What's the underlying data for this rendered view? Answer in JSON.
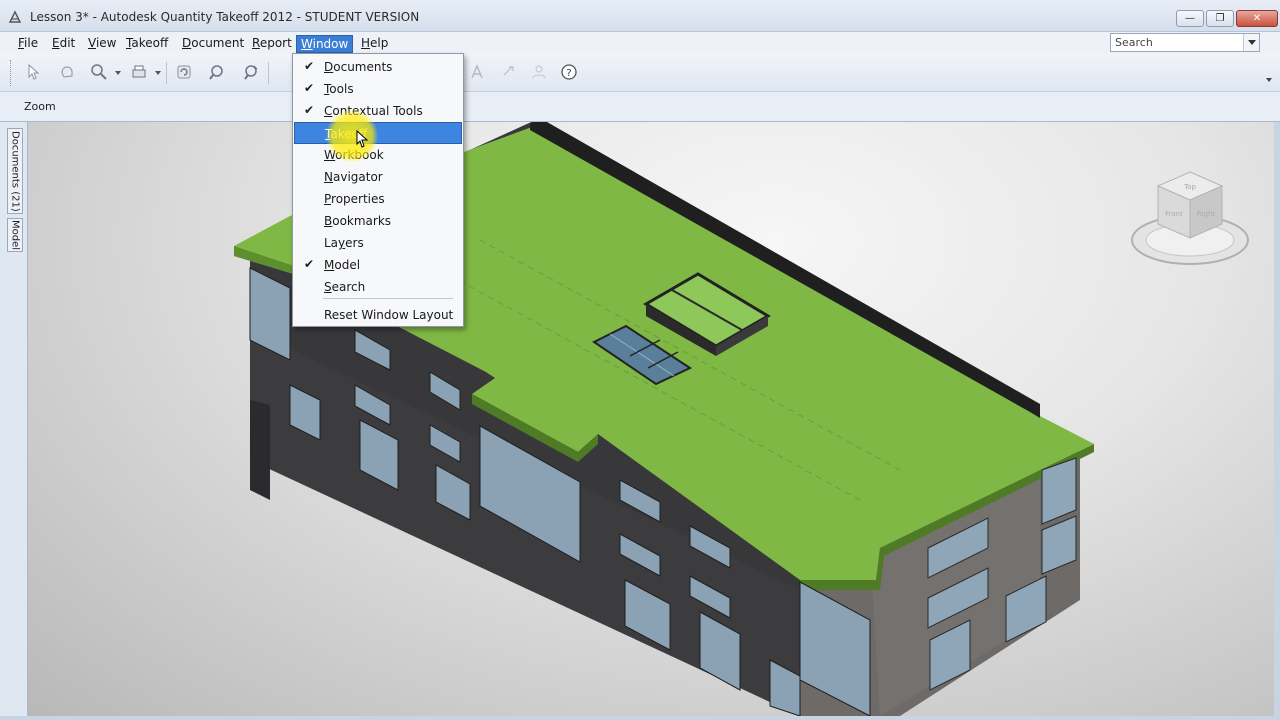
{
  "window": {
    "title": "Lesson 3* - Autodesk Quantity Takeoff 2012 - STUDENT VERSION",
    "controls": [
      "minimize",
      "maximize",
      "close"
    ]
  },
  "menubar": {
    "items": [
      {
        "label": "File",
        "mnemonic": "F",
        "rest": "ile"
      },
      {
        "label": "Edit",
        "mnemonic": "E",
        "rest": "dit"
      },
      {
        "label": "View",
        "mnemonic": "V",
        "rest": "iew"
      },
      {
        "label": "Takeoff",
        "mnemonic": "T",
        "rest": "akeoff"
      },
      {
        "label": "Document",
        "mnemonic": "D",
        "rest": "ocument"
      },
      {
        "label": "Report",
        "mnemonic": "R",
        "rest": "eport"
      },
      {
        "label": "Window",
        "mnemonic": "W",
        "rest": "indow"
      },
      {
        "label": "Help",
        "mnemonic": "H",
        "rest": "elp"
      }
    ],
    "active": "Window"
  },
  "search": {
    "value": "Search"
  },
  "toolbar": {
    "icons": [
      "select-icon",
      "pan-icon",
      "zoom-icon",
      "print-icon",
      "refresh-icon",
      "find-icon",
      "find-next-icon",
      "help-icon"
    ]
  },
  "zoomstrip": {
    "label": "Zoom"
  },
  "sidetabs": {
    "documents": "Documents (21)",
    "model": "Model"
  },
  "window_menu": {
    "items": [
      {
        "label": "Documents",
        "checked": true,
        "mnemonic_index": 0
      },
      {
        "label": "Tools",
        "checked": true,
        "mnemonic_index": 0
      },
      {
        "label": "Contextual Tools",
        "checked": true,
        "mnemonic_index": 0
      },
      {
        "label": "Takeoff",
        "checked": false,
        "highlighted": true,
        "mnemonic_index": 0
      },
      {
        "label": "Workbook",
        "checked": false,
        "mnemonic_index": 0
      },
      {
        "label": "Navigator",
        "checked": false,
        "mnemonic_index": 0
      },
      {
        "label": "Properties",
        "checked": false,
        "mnemonic_index": 0
      },
      {
        "label": "Bookmarks",
        "checked": false,
        "mnemonic_index": 0
      },
      {
        "label": "Layers",
        "checked": false,
        "mnemonic_index": 2
      },
      {
        "label": "Model",
        "checked": true,
        "mnemonic_index": 0
      },
      {
        "label": "Search",
        "checked": false,
        "mnemonic_index": 0
      }
    ],
    "footer": "Reset Window Layout"
  },
  "viewcube": {
    "faces": [
      "Top",
      "Front",
      "Right"
    ]
  },
  "colors": {
    "roof": "#7fb844",
    "roof_dark": "#5e8f2e",
    "wall_dark": "#3a3a3c",
    "wall_gray": "#6d6a68",
    "highlight": "#3d85e0",
    "menu_active": "#3a7ed6"
  }
}
